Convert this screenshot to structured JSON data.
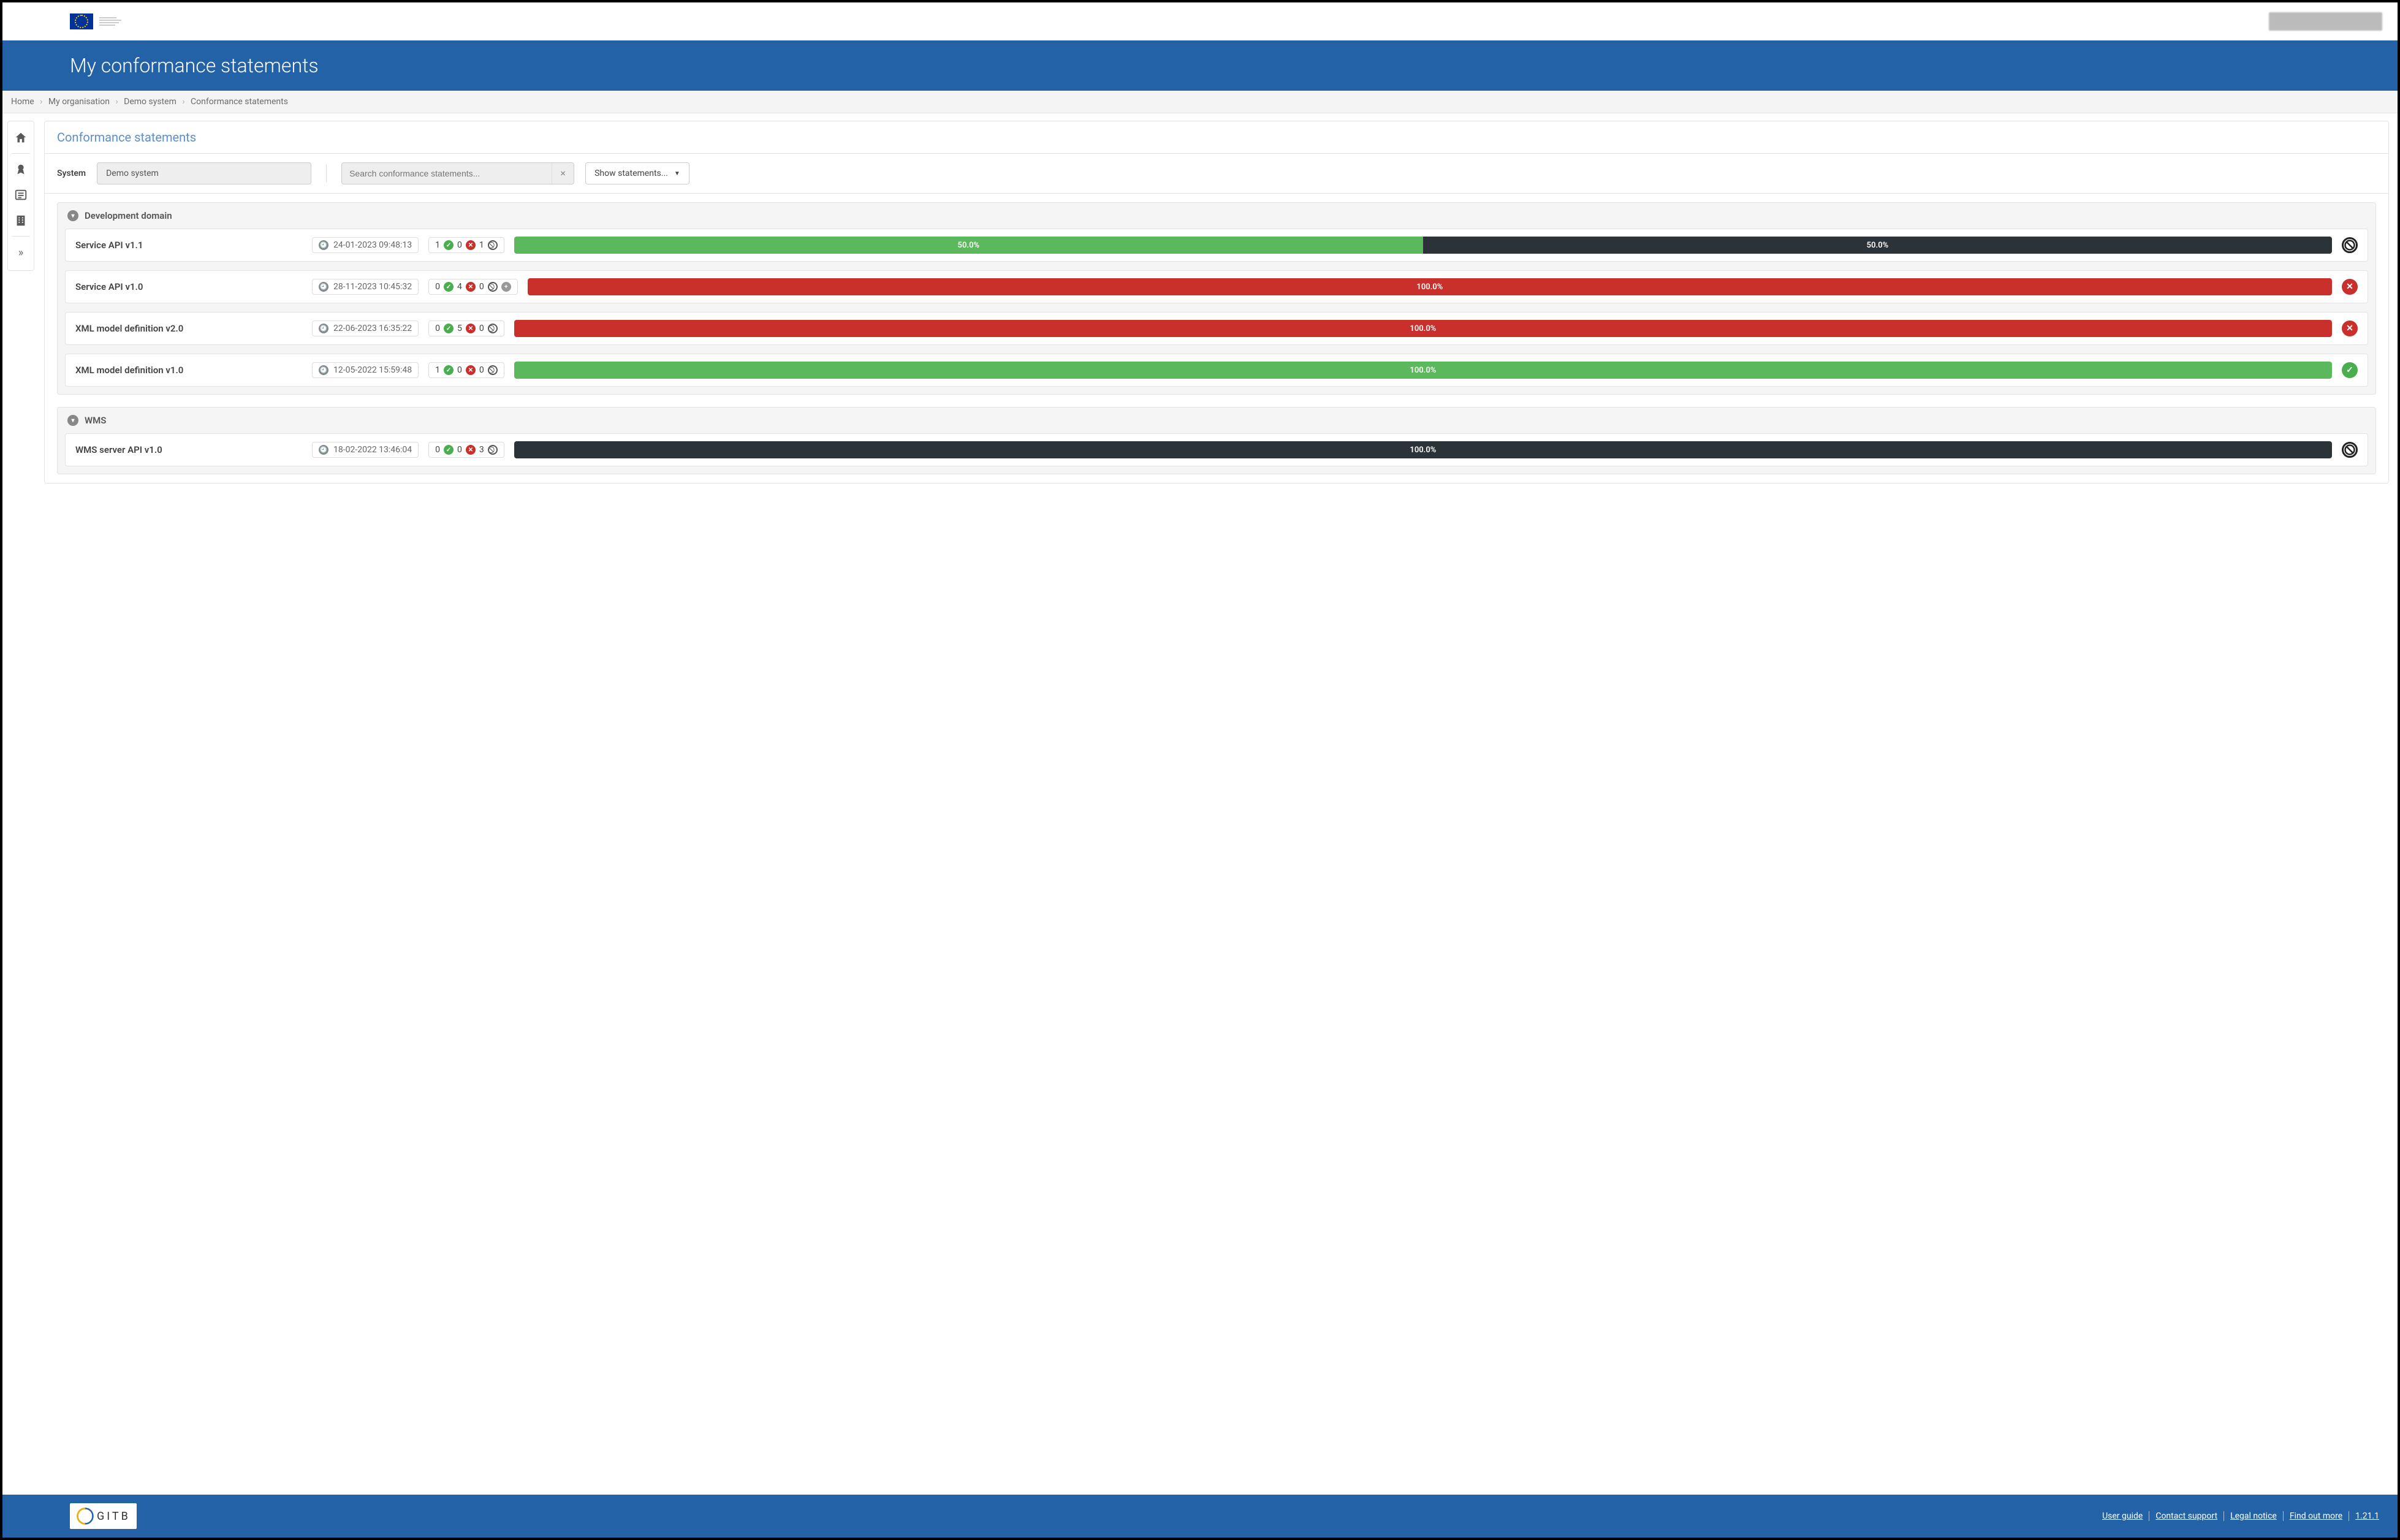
{
  "header": {
    "title": "My conformance statements"
  },
  "breadcrumb": {
    "items": [
      "Home",
      "My organisation",
      "Demo system",
      "Conformance statements"
    ]
  },
  "sidebar": {
    "icons": [
      {
        "name": "home-icon"
      },
      {
        "name": "badge-icon"
      },
      {
        "name": "list-icon"
      },
      {
        "name": "building-icon"
      }
    ]
  },
  "panel": {
    "title": "Conformance statements",
    "system_label": "System",
    "system_value": "Demo system",
    "search_placeholder": "Search conformance statements...",
    "show_label": "Show statements..."
  },
  "groups": [
    {
      "name": "Development domain",
      "statements": [
        {
          "name": "Service API v1.1",
          "timestamp": "24-01-2023 09:48:13",
          "pass": 1,
          "fail": 0,
          "skip": 1,
          "extra": null,
          "segments": [
            {
              "type": "green",
              "label": "50.0%",
              "pct": 50
            },
            {
              "type": "dark",
              "label": "50.0%",
              "pct": 50
            }
          ],
          "status": "skip"
        },
        {
          "name": "Service API v1.0",
          "timestamp": "28-11-2023 10:45:32",
          "pass": 0,
          "fail": 4,
          "skip": 0,
          "extra": "plus",
          "segments": [
            {
              "type": "red",
              "label": "100.0%",
              "pct": 100
            }
          ],
          "status": "fail"
        },
        {
          "name": "XML model definition v2.0",
          "timestamp": "22-06-2023 16:35:22",
          "pass": 0,
          "fail": 5,
          "skip": 0,
          "extra": null,
          "segments": [
            {
              "type": "red",
              "label": "100.0%",
              "pct": 100
            }
          ],
          "status": "fail"
        },
        {
          "name": "XML model definition v1.0",
          "timestamp": "12-05-2022 15:59:48",
          "pass": 1,
          "fail": 0,
          "skip": 0,
          "extra": null,
          "segments": [
            {
              "type": "green",
              "label": "100.0%",
              "pct": 100
            }
          ],
          "status": "pass"
        }
      ]
    },
    {
      "name": "WMS",
      "statements": [
        {
          "name": "WMS server API v1.0",
          "timestamp": "18-02-2022 13:46:04",
          "pass": 0,
          "fail": 0,
          "skip": 3,
          "extra": null,
          "segments": [
            {
              "type": "dark",
              "label": "100.0%",
              "pct": 100
            }
          ],
          "status": "skip"
        }
      ]
    }
  ],
  "footer": {
    "brand": "GITB",
    "links": [
      "User guide",
      "Contact support",
      "Legal notice",
      "Find out more",
      "1.21.1"
    ]
  }
}
